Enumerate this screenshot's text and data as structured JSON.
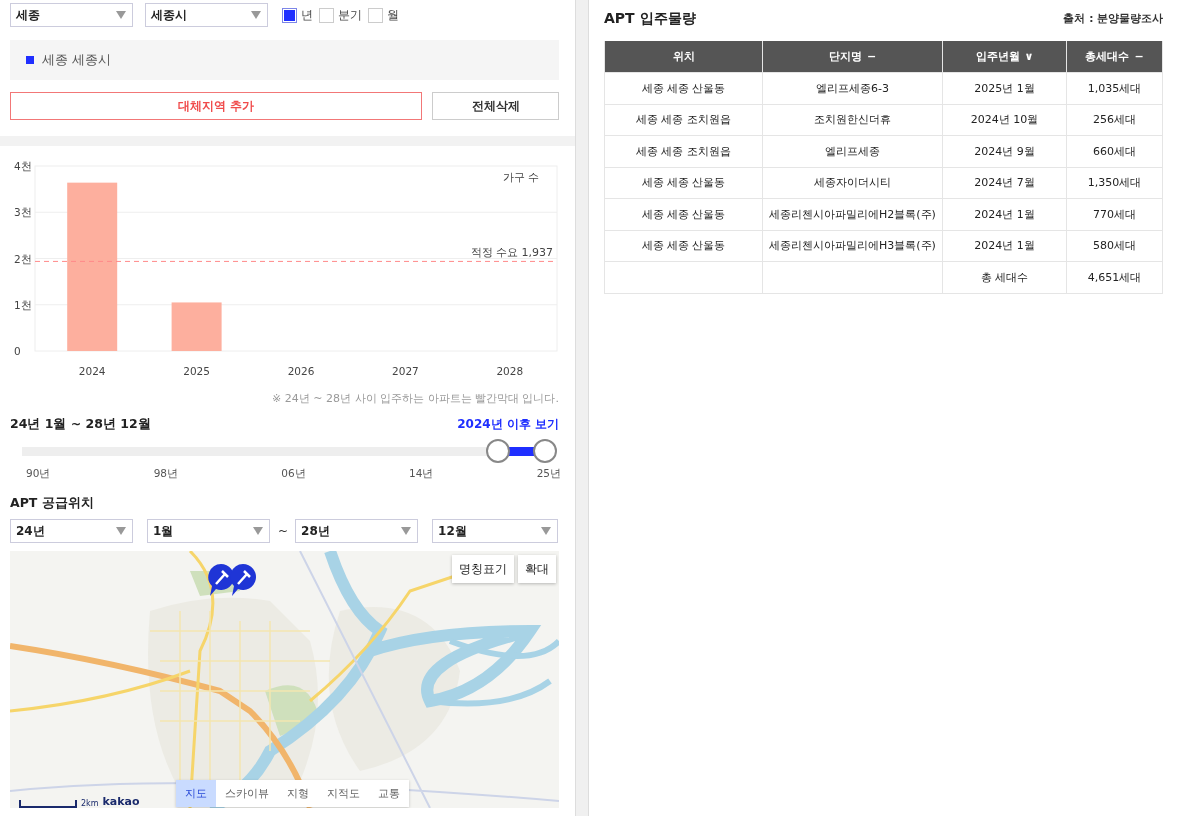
{
  "filters": {
    "selects": [
      {
        "value": "세종"
      },
      {
        "value": "세종시"
      }
    ],
    "periods": [
      {
        "label": "년",
        "checked": true
      },
      {
        "label": "분기",
        "checked": false
      },
      {
        "label": "월",
        "checked": false
      }
    ]
  },
  "region_list": [
    {
      "label": "세종 세종시",
      "color": "#1f2fff"
    }
  ],
  "buttons": [
    {
      "label": "대체지역 추가",
      "kind": "accent"
    },
    {
      "label": "전체삭제",
      "kind": "plain"
    }
  ],
  "chart": {
    "chart_data": {
      "type": "bar",
      "ylabel": "가구 수",
      "categories": [
        "2024",
        "2025",
        "2026",
        "2027",
        "2028"
      ],
      "series": [
        {
          "color": "#fdaf9e",
          "values": [
            3.64,
            1.05,
            0,
            0,
            0
          ]
        }
      ],
      "ylim": [
        0,
        4
      ],
      "yticks": [
        {
          "value": 0,
          "label": "0"
        },
        {
          "value": 1,
          "label": "1천"
        },
        {
          "value": 2,
          "label": "2천"
        },
        {
          "value": 3,
          "label": "3천"
        },
        {
          "value": 4,
          "label": "4천"
        }
      ],
      "grid": true,
      "ref_lines": [
        {
          "axis": "y",
          "value": 1.937,
          "label": "적정 수요 1,937",
          "color": "#ff8a8a"
        }
      ]
    },
    "note": "※ 24년 ~ 28년 사이 입주하는 아파트는 빨간막대 입니다."
  },
  "range": {
    "title": "24년 1월 ~ 28년 12월",
    "link": "2024년 이후 보기",
    "start": {
      "level": 0.91
    },
    "end": {
      "level": 1
    },
    "ticks": [
      "90년",
      "98년",
      "06년",
      "14년",
      "25년"
    ]
  },
  "supply": {
    "title": "APT 공급위치",
    "from": [
      {
        "value": "24년"
      },
      {
        "value": "1월"
      }
    ],
    "separator": "~",
    "to": [
      {
        "value": "28년"
      },
      {
        "value": "12월"
      }
    ],
    "map": {
      "controls": [
        "명칭표기",
        "확대"
      ],
      "tabs": [
        {
          "label": "지도",
          "selected": true
        },
        {
          "label": "스카이뷰",
          "selected": false
        },
        {
          "label": "지형",
          "selected": false
        },
        {
          "label": "지적도",
          "selected": false
        },
        {
          "label": "교통",
          "selected": false
        }
      ],
      "scale": "2km",
      "logo": "kakao"
    }
  },
  "table_panel": {
    "title": "APT 입주물량",
    "source": "출처 : 분양물량조사",
    "columns": [
      {
        "label": "위치"
      },
      {
        "label": "단지명",
        "sort_mark": "−"
      },
      {
        "label": "입주년월",
        "sort_mark": "∨"
      },
      {
        "label": "총세대수",
        "sort_mark": "−"
      }
    ],
    "rows": [
      [
        "세종 세종 산울동",
        "엘리프세종6-3",
        "2025년 1월",
        "1,035세대"
      ],
      [
        "세종 세종 조치원읍",
        "조치원한신더휴",
        "2024년 10월",
        "256세대"
      ],
      [
        "세종 세종 조치원읍",
        "엘리프세종",
        "2024년 9월",
        "660세대"
      ],
      [
        "세종 세종 산울동",
        "세종자이더시티",
        "2024년 7월",
        "1,350세대"
      ],
      [
        "세종 세종 산울동",
        "세종리첸시아파밀리에H2블록(주)",
        "2024년 1월",
        "770세대"
      ],
      [
        "세종 세종 산울동",
        "세종리첸시아파밀리에H3블록(주)",
        "2024년 1월",
        "580세대"
      ]
    ],
    "total": {
      "label": "총 세대수",
      "value": "4,651세대"
    }
  }
}
